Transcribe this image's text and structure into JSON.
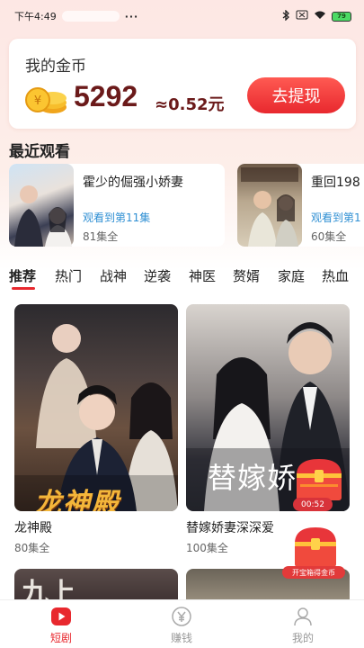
{
  "status_bar": {
    "time": "下午4:49",
    "dots": "···",
    "battery": "79"
  },
  "coin_card": {
    "title": "我的金币",
    "amount": "5292",
    "rmb": "≈0.52元",
    "withdraw_label": "去提现"
  },
  "recent": {
    "title": "最近观看",
    "items": [
      {
        "name": "霍少的倔强小娇妻",
        "progress": "观看到第11集",
        "episodes": "81集全"
      },
      {
        "name": "重回198",
        "progress": "观看到第1",
        "episodes": "60集全"
      }
    ]
  },
  "category_tabs": [
    "推荐",
    "热门",
    "战神",
    "逆袭",
    "神医",
    "赘婿",
    "家庭",
    "热血"
  ],
  "dramas": [
    {
      "title": "龙神殿",
      "episodes": "80集全",
      "poster_text": "龙神殿"
    },
    {
      "title": "替嫁娇妻深深爱",
      "episodes": "100集全",
      "poster_text": "替嫁娇"
    }
  ],
  "bottom_posters": [
    {
      "poster_text": "九上"
    },
    {
      "poster_text": ""
    }
  ],
  "floating": {
    "timer": "00:52",
    "chest_label": "开宝箱得金币"
  },
  "tab_bar": [
    {
      "label": "短剧",
      "icon": "play-icon",
      "active": true
    },
    {
      "label": "赚钱",
      "icon": "yuan-icon",
      "active": false
    },
    {
      "label": "我的",
      "icon": "user-icon",
      "active": false
    }
  ],
  "colors": {
    "accent": "#e8282e",
    "coin_text": "#6b1a1a",
    "link": "#2f8fd3"
  }
}
